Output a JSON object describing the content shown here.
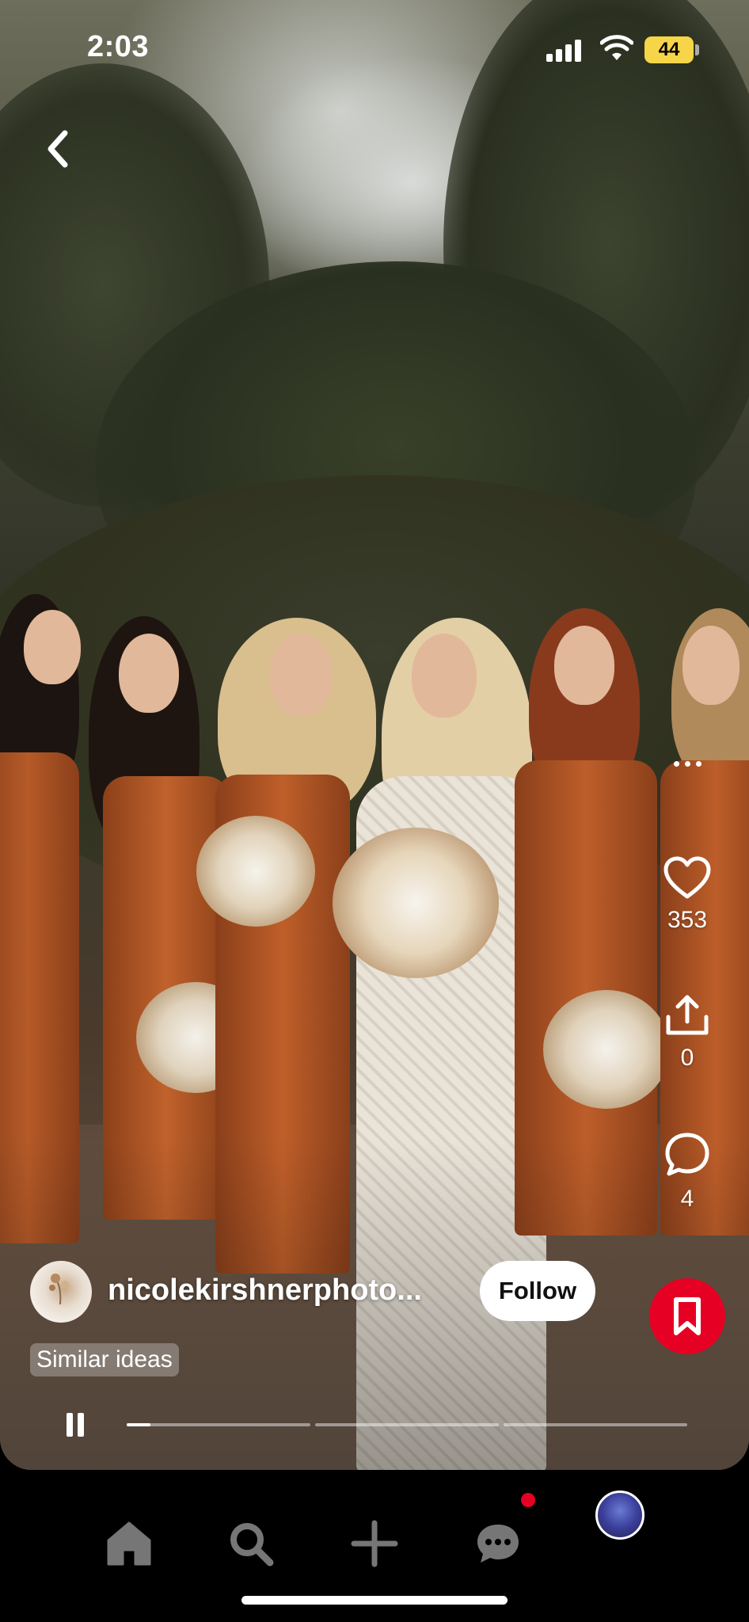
{
  "status_bar": {
    "time": "2:03",
    "battery": "44",
    "battery_color": "#f6d548"
  },
  "pin": {
    "image_alt": "Bride with bridesmaids in rust satin dresses holding bouquets under evergreen trees",
    "likes": "353",
    "shares": "0",
    "comments": "4"
  },
  "creator": {
    "name": "nicolekirshnerphoto...",
    "follow_label": "Follow"
  },
  "similar_ideas_label": "Similar ideas",
  "playback": {
    "state": "playing",
    "segments": 3,
    "progress_first_segment": 0.13
  },
  "icons": {
    "back": "chevron-left-icon",
    "more": "more-dots-icon",
    "like": "heart-icon",
    "share": "share-icon",
    "comment": "comment-icon",
    "save": "bookmark-icon",
    "pause": "pause-icon"
  },
  "tab_bar": {
    "items": [
      "home-icon",
      "search-icon",
      "plus-icon",
      "messages-icon",
      "profile-avatar"
    ],
    "notification_color": "#e60023"
  },
  "accent_color": "#e60023"
}
